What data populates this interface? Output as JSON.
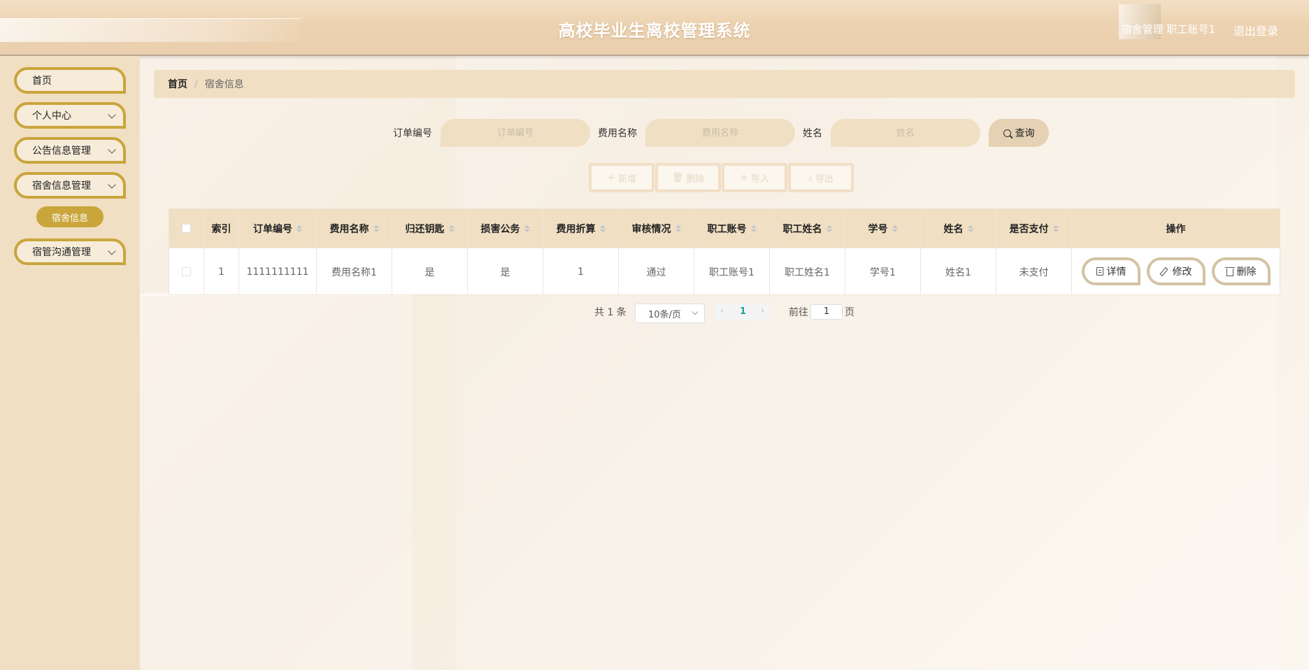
{
  "header": {
    "title": "高校毕业生离校管理系统",
    "user_label": "宿舍管理 职工账号1",
    "logout_label": "退出登录"
  },
  "sidebar": {
    "items": [
      {
        "label": "首页",
        "expandable": false
      },
      {
        "label": "个人中心",
        "expandable": true
      },
      {
        "label": "公告信息管理",
        "expandable": true
      },
      {
        "label": "宿舍信息管理",
        "expandable": true
      },
      {
        "label": "宿管沟通管理",
        "expandable": true
      }
    ],
    "active_sub": "宿舍信息"
  },
  "breadcrumb": {
    "home": "首页",
    "separator": "/",
    "current": "宿舍信息"
  },
  "search": {
    "fields": [
      {
        "label": "订单编号",
        "placeholder": "订单编号"
      },
      {
        "label": "费用名称",
        "placeholder": "费用名称"
      },
      {
        "label": "姓名",
        "placeholder": "姓名"
      }
    ],
    "button_label": "查询"
  },
  "actions": {
    "add": "新增",
    "delete": "删除",
    "import": "导入",
    "export": "导出"
  },
  "table": {
    "columns": [
      "索引",
      "订单编号",
      "费用名称",
      "归还钥匙",
      "损害公务",
      "费用折算",
      "审核情况",
      "职工账号",
      "职工姓名",
      "学号",
      "姓名",
      "是否支付",
      "操作"
    ],
    "rows": [
      [
        "1",
        "1111111111",
        "费用名称1",
        "是",
        "是",
        "1",
        "通过",
        "职工账号1",
        "职工姓名1",
        "学号1",
        "姓名1",
        "未支付"
      ]
    ],
    "row_actions": {
      "detail": "详情",
      "edit": "修改",
      "delete": "删除"
    }
  },
  "pagination": {
    "total": "共 1 条",
    "page_size": "10条/页",
    "current_page": "1",
    "goto_label": "前往",
    "goto_value": "1",
    "page_suffix": "页"
  },
  "colors": {
    "accent": "#c9a53c",
    "header_bg": "#ecd2b0",
    "sidebar_bg": "#f0dfc3",
    "page_active": "#1aa394"
  }
}
